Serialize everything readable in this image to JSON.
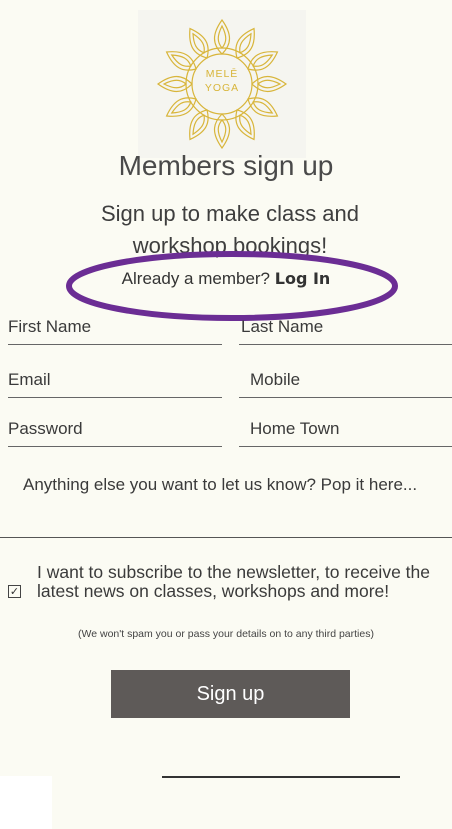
{
  "logo": {
    "line1": "MELĒ",
    "line2": "YOGA",
    "color": "#d8b53a"
  },
  "page": {
    "title": "Members sign up",
    "subtitle": "Sign up to make class and workshop bookings!"
  },
  "login_prompt": {
    "text": "Already a member?",
    "link": "Log In"
  },
  "annotation": {
    "color": "#6b2d94"
  },
  "form": {
    "first_name": "First Name",
    "last_name": "Last Name",
    "email": "Email",
    "mobile": "Mobile",
    "password": "Password",
    "home_town": "Home Town",
    "message": "Anything else you want to let us know?  Pop it here...",
    "subscribe_checked": true,
    "subscribe_label": "I want to subscribe to the newsletter, to receive the latest news on classes, workshops and more!",
    "privacy_note": "(We won't spam you or pass your details on to any third parties)",
    "submit_label": "Sign up"
  }
}
